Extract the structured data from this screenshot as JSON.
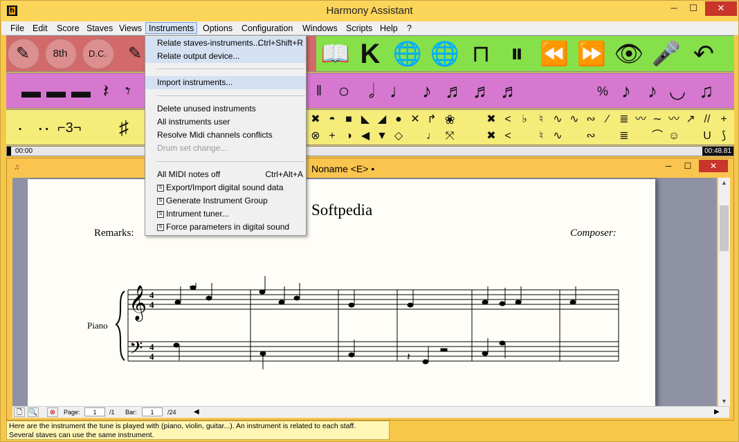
{
  "window": {
    "title": "Harmony Assistant",
    "min": "─",
    "max": "☐",
    "close": "✕"
  },
  "menubar": [
    "File",
    "Edit",
    "Score",
    "Staves",
    "Views",
    "Instruments",
    "Options",
    "Configuration",
    "Windows",
    "Scripts",
    "Help",
    "?"
  ],
  "dropdown": {
    "items": [
      {
        "label": "Relate staves-instruments...",
        "shortcut": "Ctrl+Shift+R"
      },
      {
        "label": "Relate output device...",
        "shortcut": ""
      },
      {
        "label": "Import instruments...",
        "shortcut": ""
      },
      {
        "label": "Delete unused instruments",
        "shortcut": ""
      },
      {
        "label": "All instruments user",
        "shortcut": ""
      },
      {
        "label": "Resolve Midi channels conflicts",
        "shortcut": ""
      },
      {
        "label": "Drum set change...",
        "shortcut": ""
      },
      {
        "label": "All MIDI notes off",
        "shortcut": "Ctrl+Alt+A"
      },
      {
        "label": "Export/Import digital sound data",
        "shortcut": ""
      },
      {
        "label": "Generate Instrument Group",
        "shortcut": ""
      },
      {
        "label": "Intrument tuner...",
        "shortcut": ""
      },
      {
        "label": "Force parameters in digital sound",
        "shortcut": ""
      }
    ]
  },
  "toolbar_red": [
    "8th",
    "D.C."
  ],
  "progress": {
    "start": "00:00",
    "end": "00:48.81"
  },
  "document": {
    "title": "Noname <E> •",
    "song_title": "Softpedia",
    "remarks": "Remarks:",
    "composer": "Composer:",
    "instrument": "Piano",
    "time_sig": "4"
  },
  "doc_status": {
    "page_label": "Page:",
    "page_value": "1",
    "page_total": "/1",
    "bar_label": "Bar:",
    "bar_value": "1",
    "bar_total": "/24"
  },
  "status_text_1": "Here are the instrument the tune is played with (piano, violin, guitar...). An instrument is related to each staff.",
  "status_text_2": "Several staves can use the same instrument."
}
